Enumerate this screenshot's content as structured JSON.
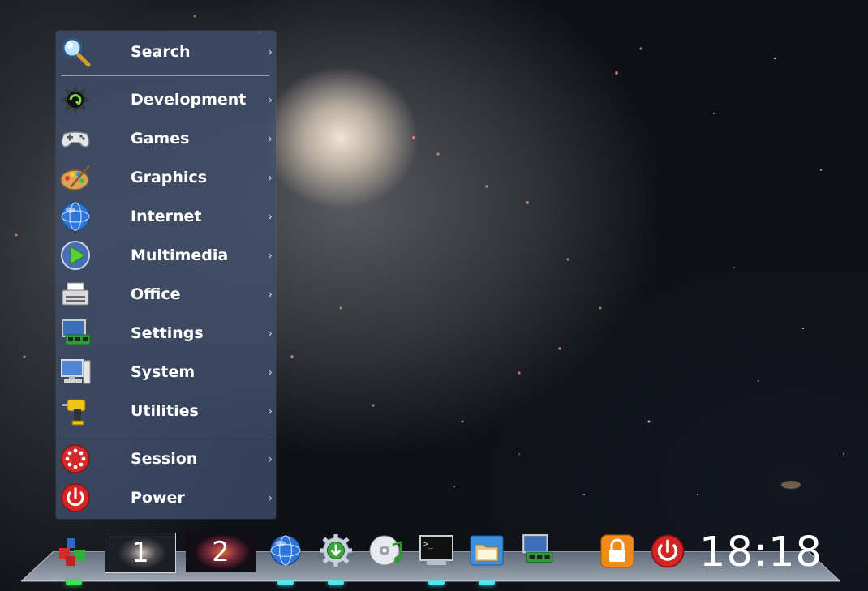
{
  "menu": {
    "items": [
      {
        "label": "Search",
        "icon": "search-icon"
      },
      {
        "label": "Development",
        "icon": "development-icon"
      },
      {
        "label": "Games",
        "icon": "gamepad-icon"
      },
      {
        "label": "Graphics",
        "icon": "palette-icon"
      },
      {
        "label": "Internet",
        "icon": "globe-icon"
      },
      {
        "label": "Multimedia",
        "icon": "play-icon"
      },
      {
        "label": "Office",
        "icon": "typewriter-icon"
      },
      {
        "label": "Settings",
        "icon": "settings-board-icon"
      },
      {
        "label": "System",
        "icon": "computer-icon"
      },
      {
        "label": "Utilities",
        "icon": "drill-icon"
      },
      {
        "label": "Session",
        "icon": "session-icon"
      },
      {
        "label": "Power",
        "icon": "power-icon"
      }
    ],
    "submenu_indicator": "›"
  },
  "taskbar": {
    "desktops": [
      {
        "label": "1"
      },
      {
        "label": "2"
      }
    ],
    "clock": "18:18"
  }
}
